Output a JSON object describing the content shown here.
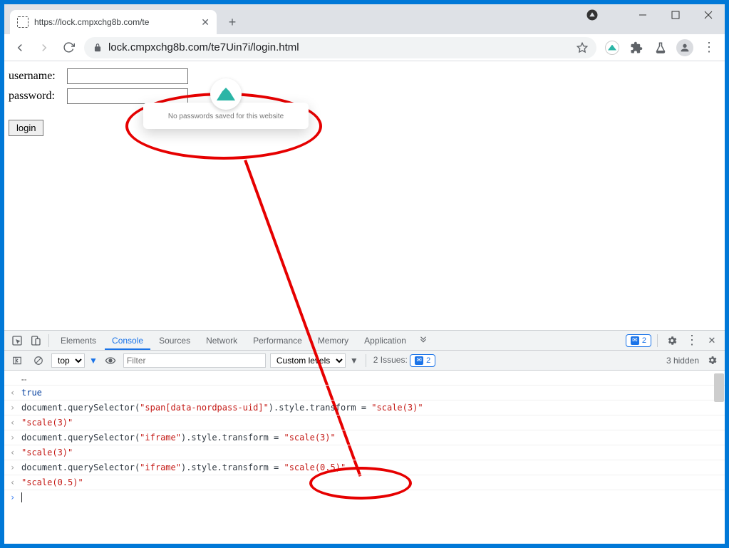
{
  "tab": {
    "title": "https://lock.cmpxchg8b.com/te"
  },
  "url": "lock.cmpxchg8b.com/te7Uin7i/login.html",
  "form": {
    "username_label": "username:",
    "password_label": "password:",
    "login_label": "login"
  },
  "popup": {
    "message": "No passwords saved for this website"
  },
  "devtools": {
    "tabs": {
      "elements": "Elements",
      "console": "Console",
      "sources": "Sources",
      "network": "Network",
      "performance": "Performance",
      "memory": "Memory",
      "application": "Application"
    },
    "error_count": "2",
    "toolbar": {
      "context": "top",
      "filter_placeholder": "Filter",
      "levels": "Custom levels",
      "issues_label": "2 Issues:",
      "issues_count": "2",
      "hidden": "3 hidden"
    },
    "lines": [
      {
        "dir": "out",
        "parts": [
          {
            "t": "true",
            "c": "tok-res"
          }
        ]
      },
      {
        "dir": "in",
        "parts": [
          {
            "t": "document.querySelector(",
            "c": "tok-default"
          },
          {
            "t": "\"span[data-nordpass-uid]\"",
            "c": "tok-str"
          },
          {
            "t": ").style.transform = ",
            "c": "tok-default"
          },
          {
            "t": "\"scale(3)\"",
            "c": "tok-str"
          }
        ]
      },
      {
        "dir": "out",
        "parts": [
          {
            "t": "\"scale(3)\"",
            "c": "tok-str"
          }
        ]
      },
      {
        "dir": "in",
        "parts": [
          {
            "t": "document.querySelector(",
            "c": "tok-default"
          },
          {
            "t": "\"iframe\"",
            "c": "tok-str"
          },
          {
            "t": ").style.transform = ",
            "c": "tok-default"
          },
          {
            "t": "\"scale(3)\"",
            "c": "tok-str"
          }
        ]
      },
      {
        "dir": "out",
        "parts": [
          {
            "t": "\"scale(3)\"",
            "c": "tok-str"
          }
        ]
      },
      {
        "dir": "in",
        "parts": [
          {
            "t": "document.querySelector(",
            "c": "tok-default"
          },
          {
            "t": "\"iframe\"",
            "c": "tok-str"
          },
          {
            "t": ").style.transform = ",
            "c": "tok-default"
          },
          {
            "t": "\"scale(0.5)\"",
            "c": "tok-str"
          }
        ]
      },
      {
        "dir": "out",
        "parts": [
          {
            "t": "\"scale(0.5)\"",
            "c": "tok-str"
          }
        ]
      }
    ]
  }
}
